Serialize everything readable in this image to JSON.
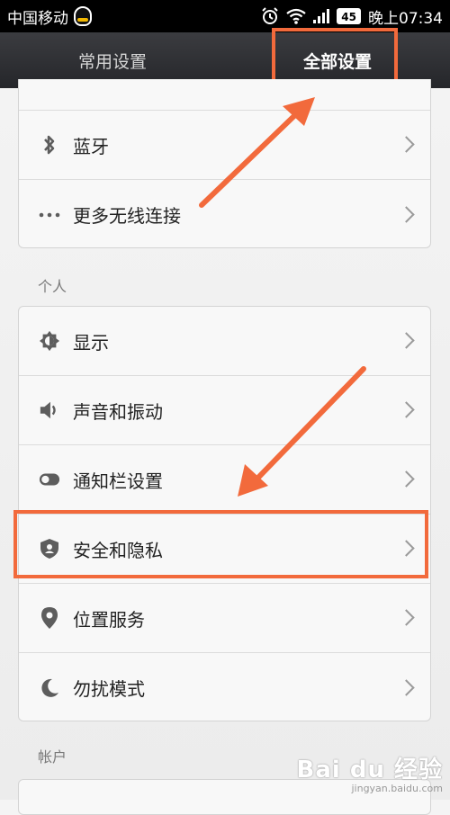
{
  "statusbar": {
    "carrier": "中国移动",
    "battery": "45",
    "time": "晚上07:34"
  },
  "tabs": {
    "common": "常用设置",
    "all": "全部设置"
  },
  "groups": {
    "wireless": [
      {
        "label": "蓝牙",
        "icon": "bluetooth-icon"
      },
      {
        "label": "更多无线连接",
        "icon": "more-dots-icon"
      }
    ],
    "personal_header": "个人",
    "personal": [
      {
        "label": "显示",
        "icon": "brightness-icon"
      },
      {
        "label": "声音和振动",
        "icon": "speaker-icon"
      },
      {
        "label": "通知栏设置",
        "icon": "toggle-icon"
      },
      {
        "label": "安全和隐私",
        "icon": "shield-icon"
      },
      {
        "label": "位置服务",
        "icon": "location-pin-icon"
      },
      {
        "label": "勿扰模式",
        "icon": "moon-icon"
      }
    ],
    "account_header": "帐户"
  },
  "watermark": {
    "brand": "Bai du 经验",
    "sub": "jingyan.baidu.com"
  },
  "colors": {
    "highlight": "#f26a3c",
    "tabbar": "#2f3034"
  }
}
